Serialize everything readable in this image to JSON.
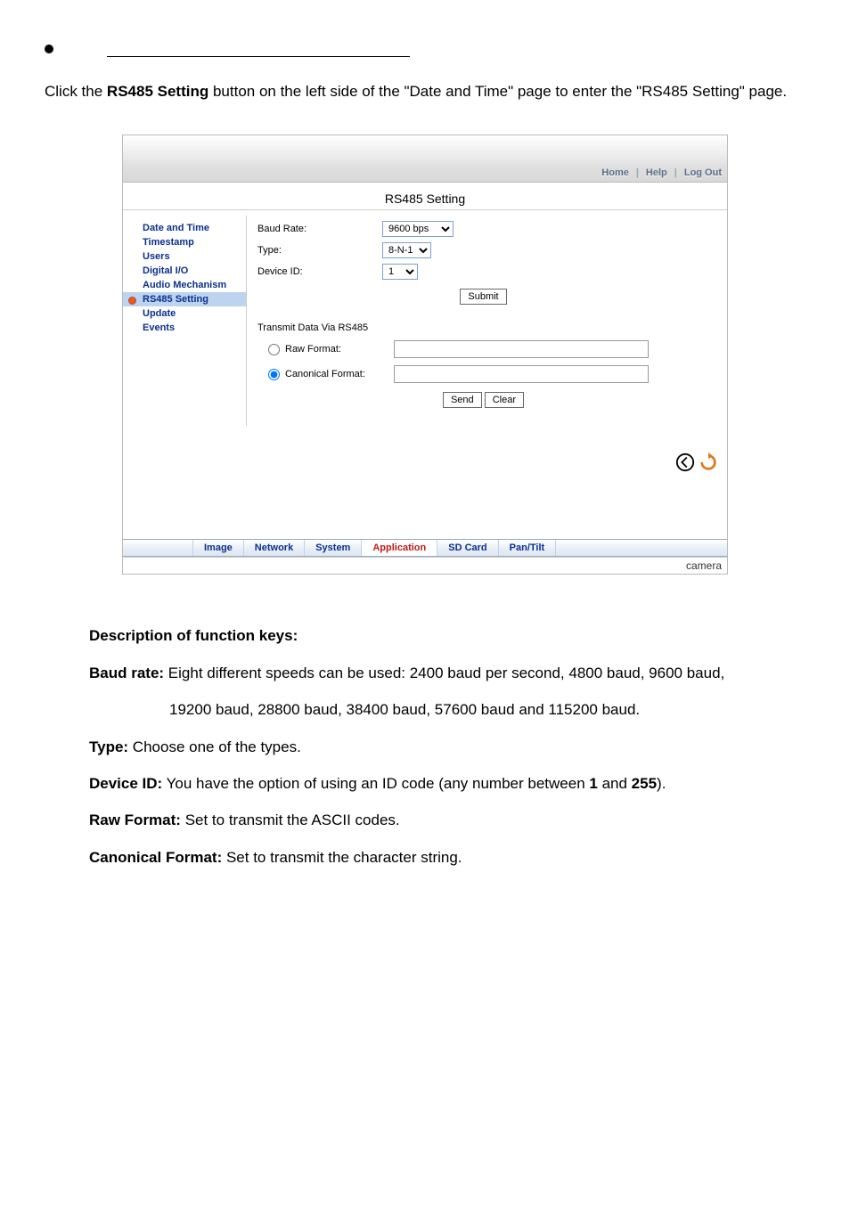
{
  "intro": {
    "pre": "Click the ",
    "bold": "RS485 Setting",
    "post": " button on the left side of the \"Date and Time\" page to enter the \"RS485 Setting\" page."
  },
  "topbar": {
    "home": "Home",
    "help": "Help",
    "logout": "Log Out"
  },
  "pageTitle": "RS485 Setting",
  "sidebar": {
    "items": [
      "Date and Time",
      "Timestamp",
      "Users",
      "Digital I/O",
      "Audio Mechanism",
      "RS485 Setting",
      "Update",
      "Events"
    ],
    "selectedIndex": 5
  },
  "form": {
    "baud_label": "Baud Rate:",
    "baud_value": "9600 bps",
    "type_label": "Type:",
    "type_value": "8-N-1",
    "device_label": "Device ID:",
    "device_value": "1",
    "submit": "Submit",
    "transmit_head": "Transmit Data Via RS485",
    "raw_label": "Raw Format:",
    "canonical_label": "Canonical Format:",
    "send": "Send",
    "clear": "Clear"
  },
  "tabs": {
    "items": [
      "Image",
      "Network",
      "System",
      "Application",
      "SD Card",
      "Pan/Tilt"
    ],
    "activeIndex": 3
  },
  "footer": "camera",
  "desc": {
    "heading": "Description of function keys:",
    "baud_key": "Baud rate:",
    "baud_text_a": " Eight different speeds can be used: 2400 baud per second, 4800 baud, 9600 baud,",
    "baud_text_b": "19200 baud, 28800 baud, 38400 baud, 57600 baud and 115200 baud.",
    "type_key": "Type:",
    "type_text": " Choose one of the types.",
    "device_key": "Device ID:",
    "device_text_a": " You have the option of using an ID code (any number between ",
    "device_one": "1",
    "device_and": " and ",
    "device_255": "255",
    "device_close": ").",
    "raw_key": "Raw Format:",
    "raw_text": " Set to transmit the ASCII codes.",
    "canon_key": "Canonical Format:",
    "canon_text": " Set to transmit the character string."
  }
}
